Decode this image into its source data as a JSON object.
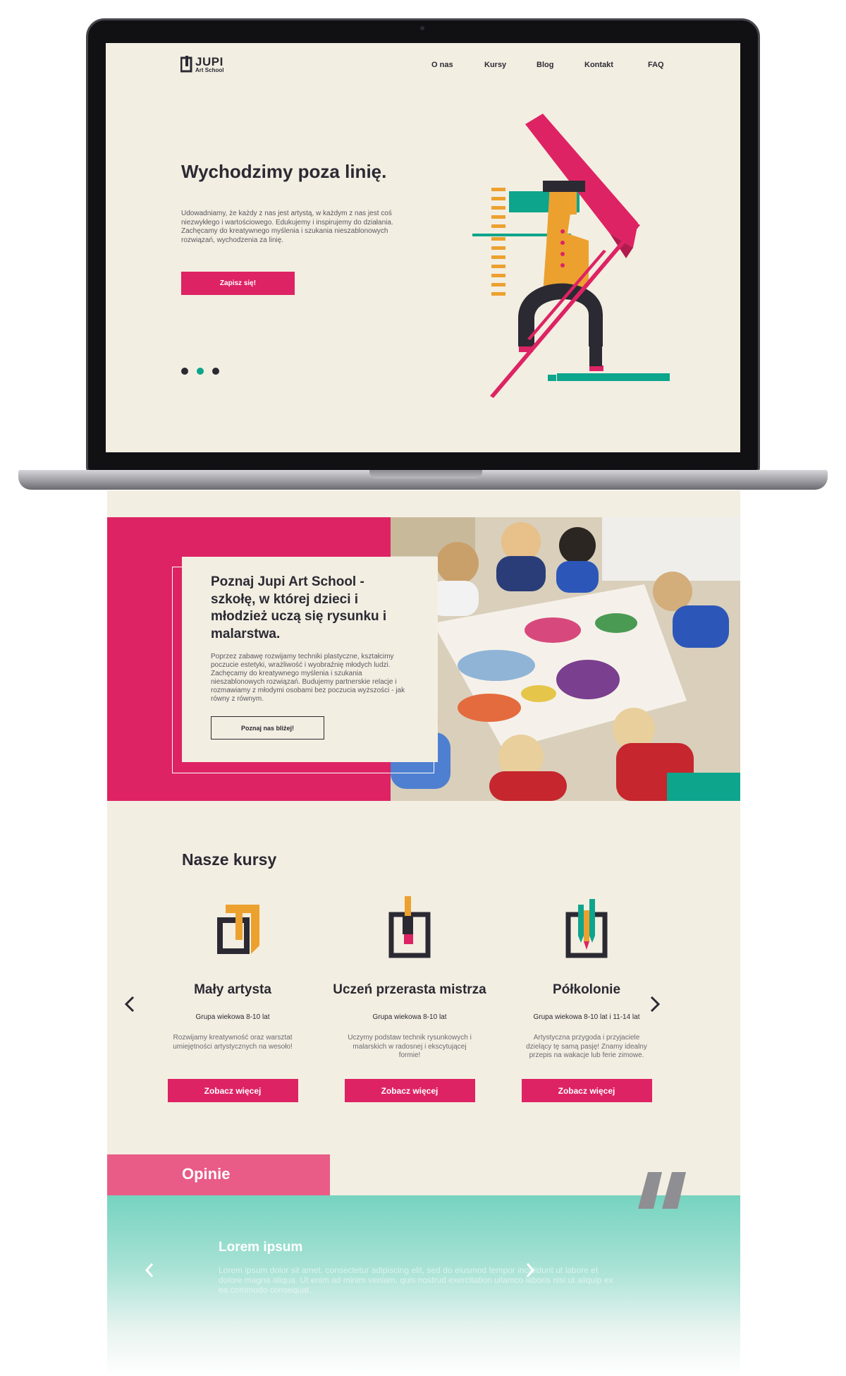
{
  "logo": {
    "name": "JUPI",
    "subtitle": "Art School"
  },
  "nav": {
    "items": [
      "O nas",
      "Kursy",
      "Blog",
      "Kontakt",
      "FAQ"
    ]
  },
  "hero": {
    "title": "Wychodzimy poza linię.",
    "text": "Udowadniamy, że każdy z nas jest artystą, w każdym z nas jest coś niezwykłego i wartościowego. Edukujemy i inspirujemy do działania. Zachęcamy do kreatywnego myślenia i szukania nieszablonowych rozwiązań, wychodzenia za linię.",
    "button": "Zapisz się!",
    "slides": 3,
    "active_slide": 2
  },
  "about": {
    "title": "Poznaj Jupi Art School - szkołę, w której dzieci i młodzież uczą się rysunku i malarstwa.",
    "text": "Poprzez zabawę rozwijamy techniki plastyczne, kształcimy poczucie estetyki, wrażliwość i wyobraźnię młodych ludzi. Zachęcamy do kreatywnego myślenia i szukania nieszablonowych rozwiązań. Budujemy partnerskie relacje i rozmawiamy z młodymi osobami bez poczucia wyższości - jak równy z równym.",
    "button": "Poznaj nas bliżej!"
  },
  "courses": {
    "title": "Nasze kursy",
    "items": [
      {
        "name": "Mały artysta",
        "age": "Grupa wiekowa 8-10 lat",
        "desc": "Rozwijamy kreatywność oraz warsztat umiejętności artystycznych na wesoło!",
        "button": "Zobacz więcej",
        "icon": "frame-icon"
      },
      {
        "name": "Uczeń przerasta mistrza",
        "age": "Grupa wiekowa 8-10 lat",
        "desc": "Uczymy podstaw technik rysunkowych i malarskich w radosnej i ekscytującej formie!",
        "button": "Zobacz więcej",
        "icon": "brush-frame-icon"
      },
      {
        "name": "Półkolonie",
        "age": "Grupa wiekowa 8-10 lat i 11-14 lat",
        "desc": "Artystyczna przygoda i przyjaciele dzielący tę samą pasję! Znamy idealny przepis na wakacje lub ferie zimowe.",
        "button": "Zobacz więcej",
        "icon": "pencils-frame-icon"
      }
    ]
  },
  "opinions": {
    "title": "Opinie",
    "name": "Lorem ipsum",
    "text": "Lorem ipsum dolor sit amet, consectetur adipiscing elit, sed do eiusmod tempor incididunt ut labore et dolore magna aliqua. Ut enim ad minim veniam, quis nostrud exercitation ullamco laboris nisi ut aliquip ex ea commodo consequat."
  },
  "colors": {
    "accent": "#dd2363",
    "teal": "#0da58c",
    "mustard": "#eca12f",
    "dark": "#2b2a33",
    "background": "#f3eee2"
  }
}
